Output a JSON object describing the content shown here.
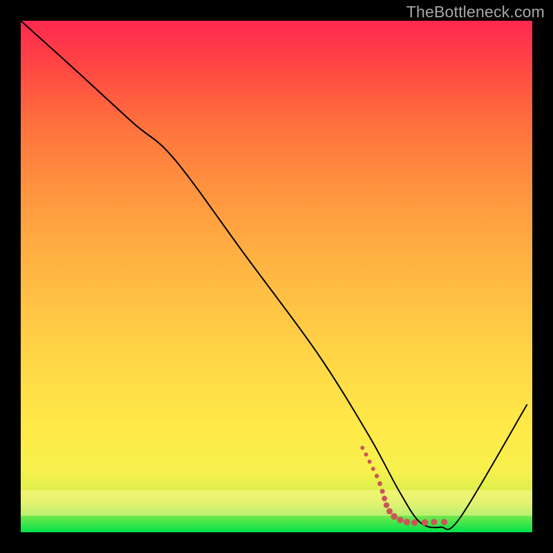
{
  "watermark": "TheBottleneck.com",
  "chart_data": {
    "type": "line",
    "title": "",
    "xlabel": "",
    "ylabel": "",
    "xlim": [
      0,
      100
    ],
    "ylim": [
      0,
      100
    ],
    "series": [
      {
        "name": "bottleneck-curve",
        "x": [
          0,
          10,
          22,
          30,
          44,
          58,
          68,
          74,
          78,
          82,
          86,
          99
        ],
        "y": [
          100,
          91,
          80,
          73,
          54,
          35,
          19,
          8,
          2,
          1,
          3,
          25
        ]
      }
    ],
    "dots": {
      "name": "optimal-cluster",
      "color": "#c95757",
      "points": [
        {
          "x": 66.8,
          "y": 16.5,
          "r": 3.0
        },
        {
          "x": 67.5,
          "y": 15.2,
          "r": 3.0
        },
        {
          "x": 68.2,
          "y": 13.8,
          "r": 3.0
        },
        {
          "x": 68.9,
          "y": 12.4,
          "r": 3.0
        },
        {
          "x": 69.6,
          "y": 11.0,
          "r": 3.2
        },
        {
          "x": 70.2,
          "y": 9.5,
          "r": 3.4
        },
        {
          "x": 70.7,
          "y": 8.0,
          "r": 3.6
        },
        {
          "x": 71.1,
          "y": 6.6,
          "r": 4.0
        },
        {
          "x": 71.5,
          "y": 5.3,
          "r": 4.2
        },
        {
          "x": 72.1,
          "y": 4.1,
          "r": 4.5
        },
        {
          "x": 73.0,
          "y": 3.1,
          "r": 4.8
        },
        {
          "x": 74.2,
          "y": 2.4,
          "r": 4.8
        },
        {
          "x": 75.5,
          "y": 2.0,
          "r": 4.8
        },
        {
          "x": 77.0,
          "y": 1.9,
          "r": 4.8
        },
        {
          "x": 79.0,
          "y": 1.9,
          "r": 4.8
        },
        {
          "x": 80.8,
          "y": 2.0,
          "r": 4.6
        },
        {
          "x": 82.8,
          "y": 2.0,
          "r": 4.6
        }
      ]
    },
    "gradient": {
      "top_color": "#ff2850",
      "mid_color": "#ffd946",
      "bottom_color": "#00e24a"
    }
  }
}
